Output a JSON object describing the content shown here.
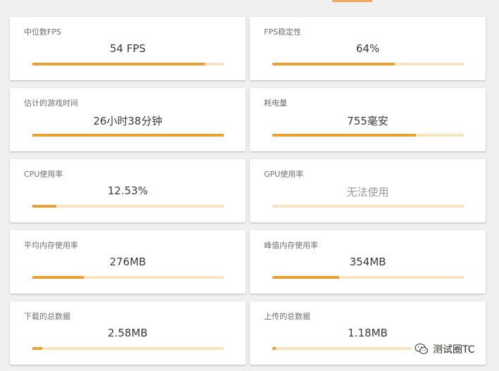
{
  "cards": [
    {
      "label": "中位数FPS",
      "value": "54 FPS",
      "progress": 0.9
    },
    {
      "label": "FPS稳定性",
      "value": "64%",
      "progress": 0.64
    },
    {
      "label": "估计的游戏时间",
      "value": "26小时38分钟",
      "progress": 1.0
    },
    {
      "label": "耗电量",
      "value": "755毫安",
      "progress": 0.75
    },
    {
      "label": "CPU使用率",
      "value": "12.53%",
      "progress": 0.125
    },
    {
      "label": "GPU使用率",
      "value": "无法使用",
      "progress": 0.0
    },
    {
      "label": "平均内存使用率",
      "value": "276MB",
      "progress": 0.27
    },
    {
      "label": "峰值内存使用率",
      "value": "354MB",
      "progress": 0.35
    },
    {
      "label": "下载的总数据",
      "value": "2.58MB",
      "progress": 0.05
    },
    {
      "label": "上传的总数据",
      "value": "1.18MB",
      "progress": 0.02
    }
  ],
  "watermark": {
    "text": "测试圈TC"
  },
  "colors": {
    "accent": "#eca02f",
    "track": "#fbe3c2",
    "tab_indicator": "#f2a65a"
  }
}
